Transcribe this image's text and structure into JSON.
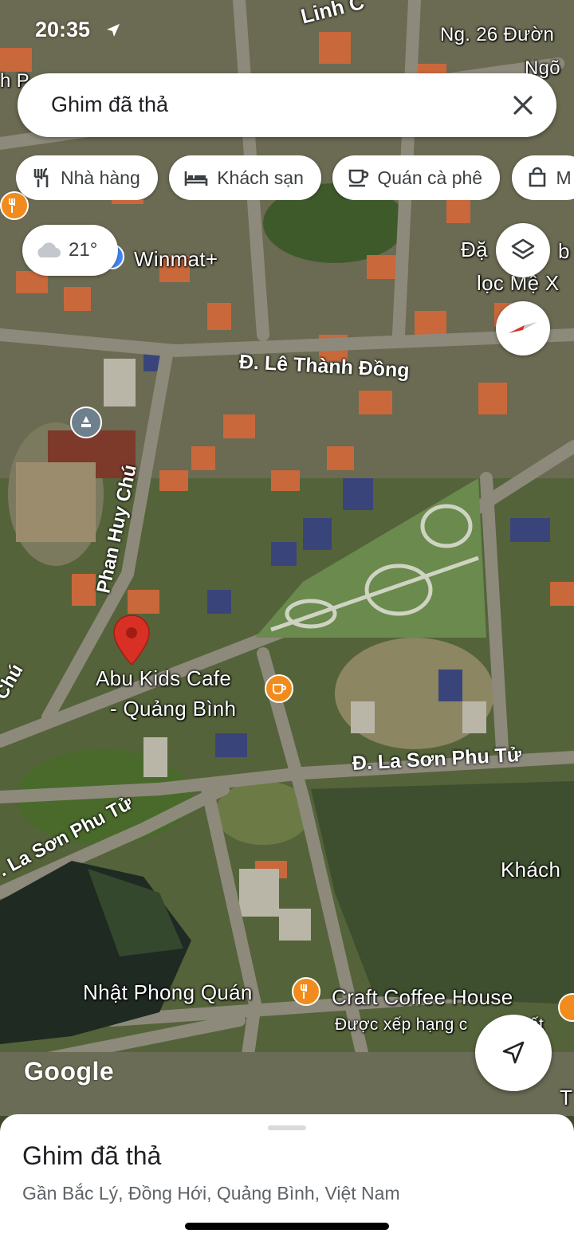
{
  "status_bar": {
    "time": "20:35"
  },
  "search": {
    "text": "Ghim đã thả"
  },
  "chips": [
    {
      "label": "Nhà hàng",
      "icon": "restaurant-icon"
    },
    {
      "label": "Khách sạn",
      "icon": "hotel-icon"
    },
    {
      "label": "Quán cà phê",
      "icon": "coffee-icon"
    },
    {
      "label": "M",
      "icon": "shopping-bag-icon"
    }
  ],
  "weather": {
    "temperature": "21°",
    "icon": "cloud-icon"
  },
  "map_labels": {
    "top_road": "Linh C",
    "top_right_1": "Ng. 26 Đườn",
    "top_right_2": "Ngõ",
    "top_left": "h P",
    "winmart": "Winmat+",
    "right_1": "Đặ",
    "right_1b": "b",
    "right_2": "lọc Mệ X",
    "le_thanh_dong": "Đ. Lê Thành Đồng",
    "phan_huy_chu": "Phan Huy Chú",
    "left_chu": "Chú",
    "abu_line1": "Abu Kids Cafe",
    "abu_line2": "- Quảng Bình",
    "la_son_phu_tu_right": "Đ. La Sơn Phu Tử",
    "la_son_phu_tu_left": ". La Sơn Phu Tử",
    "khach": "Khách",
    "nhat_phong": "Nhật Phong Quán",
    "craft_coffee": "Craft Coffee House",
    "craft_sub": "Được xếp hạng c",
    "craft_sub2": "ất",
    "edge_t": "T",
    "google": "Google"
  },
  "bottom_sheet": {
    "title": "Ghim đã thả",
    "subtitle": "Gần Bắc Lý, Đồng Hới, Quảng Bình, Việt Nam"
  },
  "colors": {
    "pin_red": "#d93025",
    "poi_orange": "#f28b1e",
    "poi_gray": "#6e7f8d",
    "poi_blue": "#4285f4"
  }
}
